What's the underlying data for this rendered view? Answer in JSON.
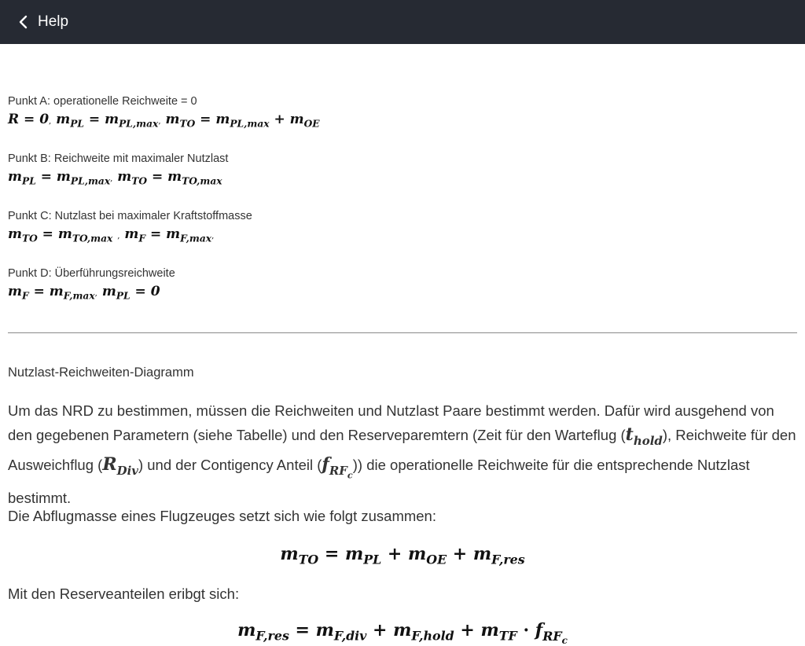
{
  "header": {
    "title": "Help",
    "back_icon": "chevron-left-icon",
    "background": "#262a33"
  },
  "points": [
    {
      "label": "Punkt A: operationelle Reichweite = 0",
      "formula": "R = 0, m_PL = m_PL,max, m_TO = m_PL,max + m_OE"
    },
    {
      "label": "Punkt B: Reichweite mit maximaler Nutzlast",
      "formula": "m_PL = m_PL,max, m_TO = m_TO,max"
    },
    {
      "label": "Punkt C: Nutzlast bei maximaler Kraftstoffmasse",
      "formula": "m_TO = m_TO,max, m_F = m_F,max,"
    },
    {
      "label": "Punkt D: Überführungsreichweite",
      "formula": "m_F = m_F,max, m_PL = 0"
    }
  ],
  "section": {
    "heading": "Nutzlast-Reichweiten-Diagramm",
    "para1_a": "Um das NRD zu bestimmen, müssen die Reichweiten und Nutzlast Paare bestimmt werden. Dafür wird ausgehend von den gegebenen Parametern (siehe Tabelle) und den Reserveparemtern (Zeit für den Warteflug (",
    "para1_math1": "t_hold",
    "para1_b": "), Reichweite für den Ausweichflug (",
    "para1_math2": "R_Div",
    "para1_c": ") und der Contigency Anteil (",
    "para1_math3": "f_RF_c",
    "para1_d": ")) die operationelle Reichweite für die entsprechende Nutzlast bestimmt.",
    "para2": "Die Abflugmasse eines Flugzeuges setzt sich wie folgt zusammen:",
    "formula1": "m_TO = m_PL + m_OE + m_F,res",
    "para3": "Mit den Reserveanteilen eribgt sich:",
    "formula2": "m_F,res = m_F,div + m_F,hold + m_TF · f_RF_c"
  }
}
